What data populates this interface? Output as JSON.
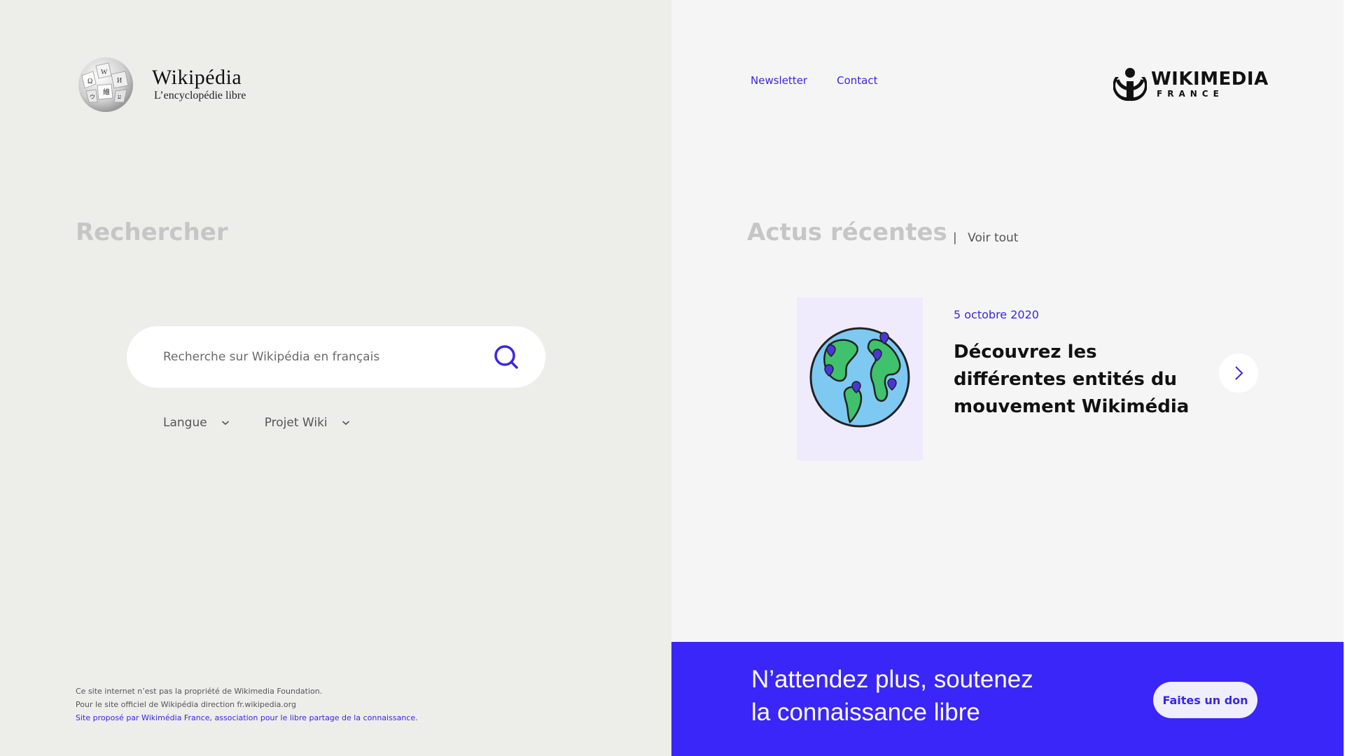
{
  "header": {
    "wikipedia_logo_name": "Wikipédia",
    "wikipedia_logo_tagline": "L’encyclopédie libre",
    "nav": [
      {
        "label": "Newsletter"
      },
      {
        "label": "Contact"
      }
    ],
    "wikimedia_logo_name": "WIKIMEDIA",
    "wikimedia_logo_sub": "FRANCE"
  },
  "search": {
    "title": "Rechercher",
    "placeholder": "Recherche sur Wikipédia en français",
    "filters": [
      {
        "label": "Langue"
      },
      {
        "label": "Projet Wiki"
      }
    ]
  },
  "footer": {
    "line1": "Ce site internet n’est pas la propriété de Wikimedia Foundation.",
    "line2": "Pour le site officiel de Wikipédia direction fr.wikipedia.org",
    "line3": "Site proposé par Wikimédia France, association pour le libre partage de la connaissance."
  },
  "news": {
    "title": "Actus récentes",
    "separator": "|",
    "see_all": "Voir tout",
    "item": {
      "date": "5 octobre 2020",
      "headline": "Découvrez les différentes entités du mouvement Wikimédia"
    }
  },
  "banner": {
    "line1": "N’attendez plus, soutenez",
    "line2": "la connaissance libre",
    "donate_label": "Faites un don"
  },
  "colors": {
    "accent": "#3a26e6",
    "banner": "#3a26f8",
    "left_bg": "#ededea",
    "right_bg": "#f5f5f5"
  }
}
